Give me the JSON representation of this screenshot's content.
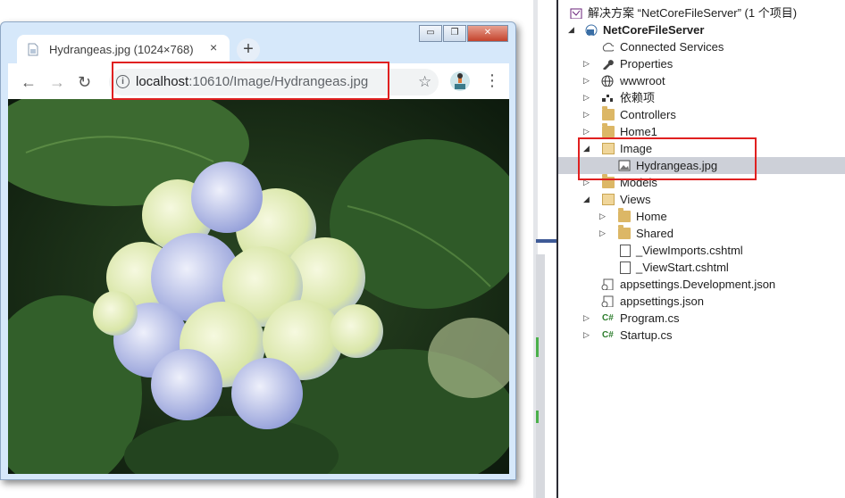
{
  "browser": {
    "tab_title": "Hydrangeas.jpg (1024×768)",
    "tab_close": "×",
    "new_tab": "+",
    "window_buttons": {
      "minimize": "▭",
      "restore": "❐",
      "close": "✕"
    },
    "nav": {
      "back": "←",
      "forward": "→",
      "reload": "↻"
    },
    "url_host": "localhost",
    "url_path": ":10610/Image/Hydrangeas.jpg",
    "info_icon": "i",
    "star": "☆",
    "menu": "⋮",
    "image_alt": "Hydrangeas.jpg"
  },
  "solution_explorer": {
    "solution": {
      "label": "解决方案 “NetCoreFileServer” (1 个项目)"
    },
    "project": {
      "label": "NetCoreFileServer"
    },
    "items": [
      {
        "label": "Connected Services"
      },
      {
        "label": "Properties"
      },
      {
        "label": "wwwroot"
      },
      {
        "label": "依赖项"
      },
      {
        "label": "Controllers"
      },
      {
        "label": "Home1"
      },
      {
        "label": "Image"
      },
      {
        "label": "Hydrangeas.jpg"
      },
      {
        "label": "Models"
      },
      {
        "label": "Views"
      },
      {
        "label": "Home"
      },
      {
        "label": "Shared"
      },
      {
        "label": "_ViewImports.cshtml"
      },
      {
        "label": "_ViewStart.cshtml"
      },
      {
        "label": "appsettings.Development.json"
      },
      {
        "label": "appsettings.json"
      },
      {
        "label": "Program.cs"
      },
      {
        "label": "Startup.cs"
      }
    ],
    "cs_icon": "C#"
  }
}
